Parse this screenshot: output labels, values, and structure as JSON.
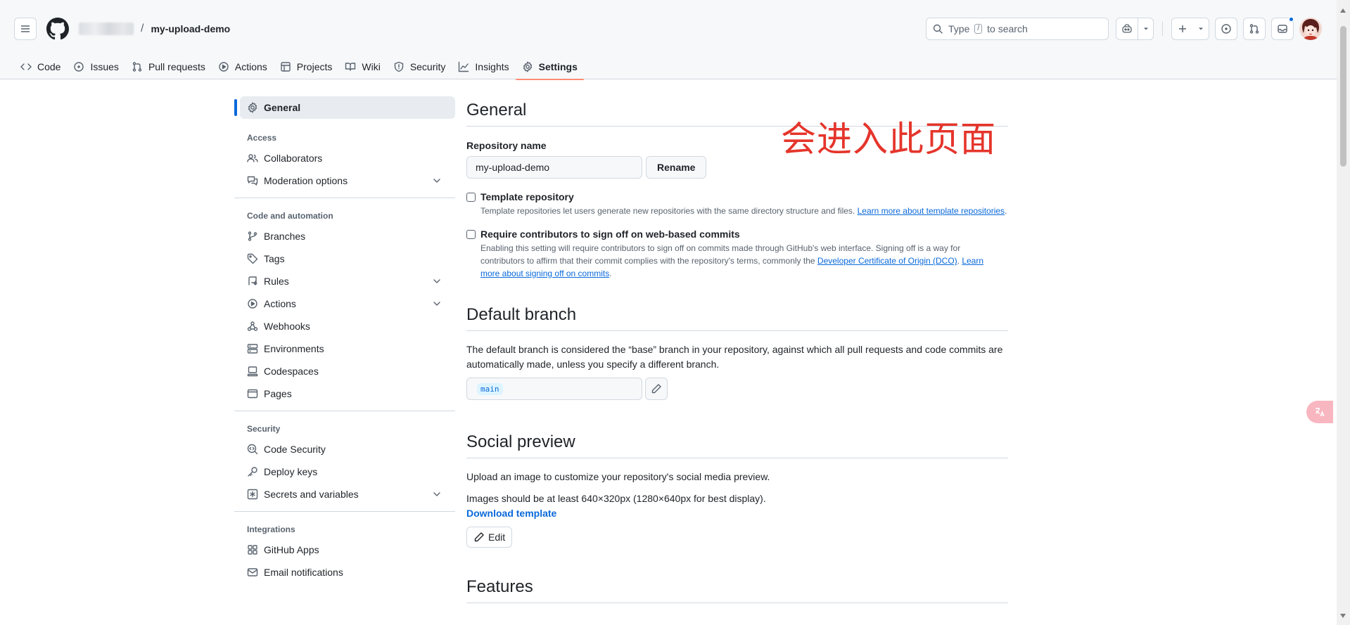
{
  "header": {
    "repo_name": "my-upload-demo",
    "separator": "/",
    "search_placeholder": "Type",
    "search_key": "/",
    "search_suffix": "to search"
  },
  "tabs": [
    {
      "label": "Code",
      "icon": "code-icon"
    },
    {
      "label": "Issues",
      "icon": "issue-icon"
    },
    {
      "label": "Pull requests",
      "icon": "pull-request-icon"
    },
    {
      "label": "Actions",
      "icon": "play-icon"
    },
    {
      "label": "Projects",
      "icon": "table-icon"
    },
    {
      "label": "Wiki",
      "icon": "book-icon"
    },
    {
      "label": "Security",
      "icon": "shield-icon"
    },
    {
      "label": "Insights",
      "icon": "graph-icon"
    },
    {
      "label": "Settings",
      "icon": "gear-icon",
      "active": true
    }
  ],
  "sidenav": {
    "general": "General",
    "access_header": "Access",
    "collaborators": "Collaborators",
    "moderation": "Moderation options",
    "code_header": "Code and automation",
    "branches": "Branches",
    "tags": "Tags",
    "rules": "Rules",
    "actions": "Actions",
    "webhooks": "Webhooks",
    "environments": "Environments",
    "codespaces": "Codespaces",
    "pages": "Pages",
    "security_header": "Security",
    "code_security": "Code Security",
    "deploy_keys": "Deploy keys",
    "secrets": "Secrets and variables",
    "integrations_header": "Integrations",
    "github_apps": "GitHub Apps",
    "email_notifications": "Email notifications"
  },
  "general": {
    "title": "General",
    "repo_name_label": "Repository name",
    "repo_name_value": "my-upload-demo",
    "rename_button": "Rename",
    "template_label": "Template repository",
    "template_note": "Template repositories let users generate new repositories with the same directory structure and files.",
    "template_link": "Learn more about template repositories",
    "signoff_label": "Require contributors to sign off on web-based commits",
    "signoff_note_1": "Enabling this setting will require contributors to sign off on commits made through GitHub's web interface. Signing off is a way for contributors to affirm that their commit complies with the repository's terms, commonly the",
    "signoff_link_dco": "Developer Certificate of Origin (DCO)",
    "signoff_link_learn": "Learn more about signing off on commits"
  },
  "default_branch": {
    "title": "Default branch",
    "description": "The default branch is considered the “base” branch in your repository, against which all pull requests and code commits are automatically made, unless you specify a different branch.",
    "branch": "main"
  },
  "social_preview": {
    "title": "Social preview",
    "description": "Upload an image to customize your repository's social media preview.",
    "size_note": "Images should be at least 640×320px (1280×640px for best display).",
    "download_link": "Download template",
    "edit_button": "Edit"
  },
  "features": {
    "title": "Features"
  },
  "annotation": "会进入此页面",
  "colors": {
    "accent": "#0969da",
    "tab_underline": "#fd8c73",
    "annotation": "#e5352b"
  }
}
